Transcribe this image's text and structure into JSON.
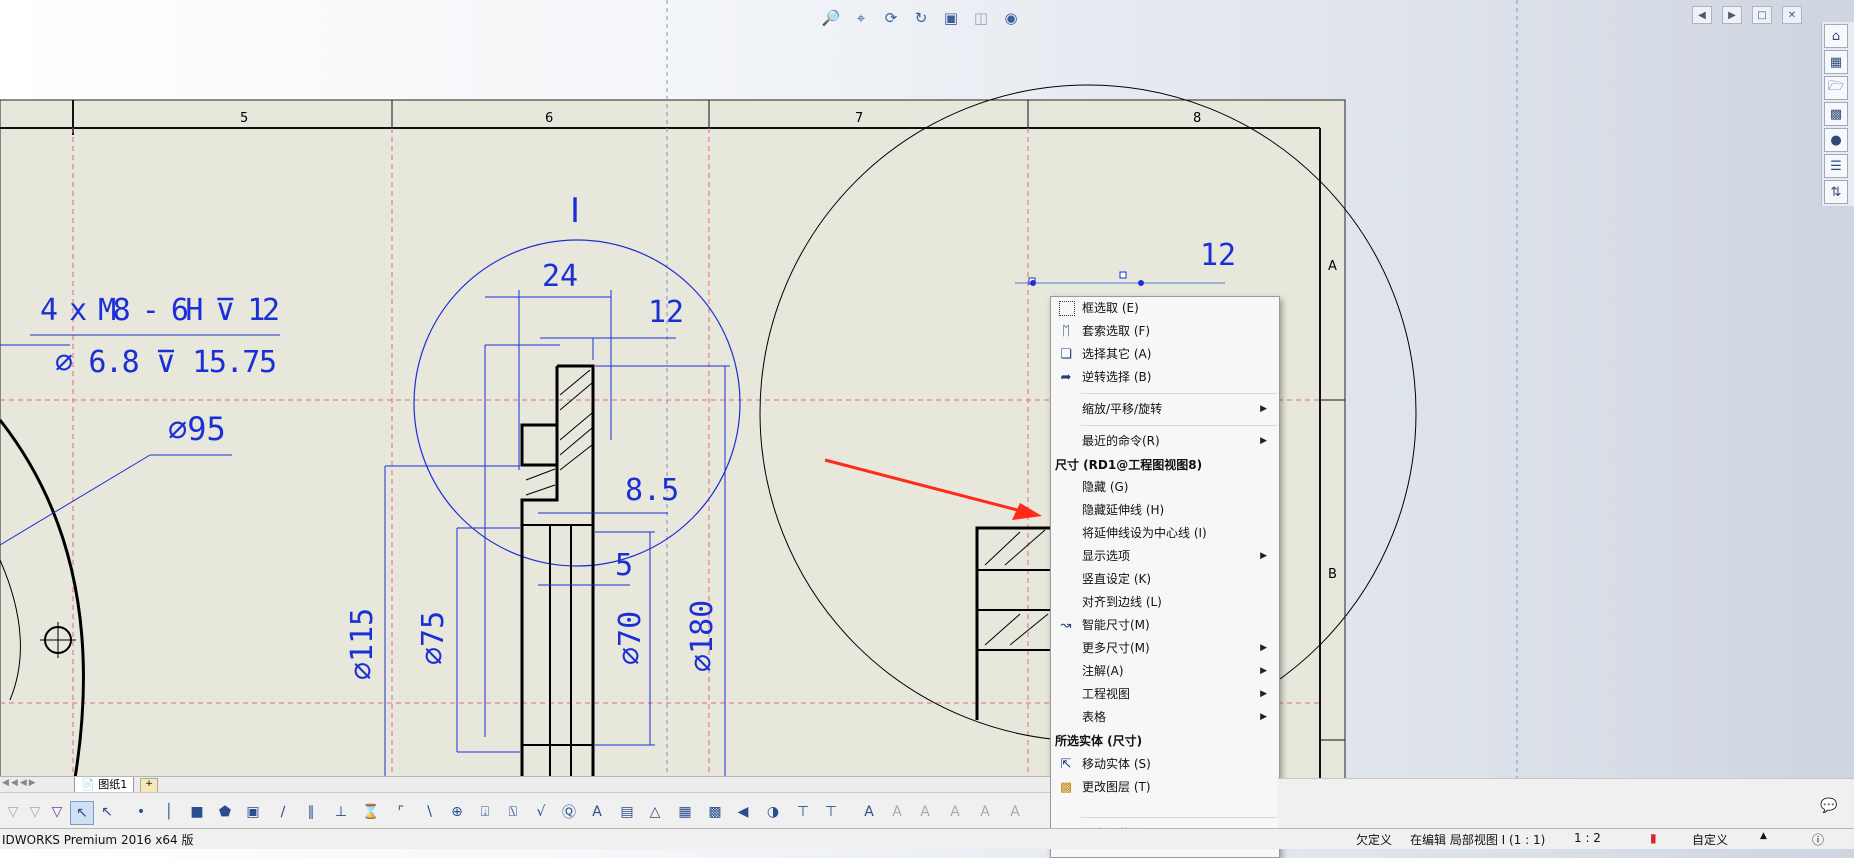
{
  "heads_up_toolbar": {
    "icons": [
      "zoom-fit-icon",
      "zoom-area-icon",
      "previous-view-icon",
      "rotate-icon",
      "section-view-icon",
      "display-style-icon",
      "hide-show-icon"
    ]
  },
  "drawing": {
    "zone_labels": [
      "5",
      "6",
      "7",
      "8"
    ],
    "row_labels": [
      "A",
      "B"
    ],
    "view_label": "I",
    "dimensions": {
      "hole_callout_line1": "4 x M8 - 6H ⊽ 12",
      "hole_callout_line2": "⌀ 6.8 ⊽ 15.75",
      "dia95": "⌀95",
      "d24": "24",
      "d12a": "12",
      "d85": "8.5",
      "d5": "5",
      "dia115": "⌀115",
      "dia75": "⌀75",
      "dia70": "⌀70",
      "dia180": "⌀180",
      "d12b": "12"
    },
    "colors": {
      "sheet": "#e8e7dc",
      "dimension": "#1b2fd6",
      "centerline": "#e26a8a",
      "arrow": "#ff2a1a"
    }
  },
  "context_menu": {
    "items": [
      {
        "icon": "box-select-icon",
        "label": "框选取 (E)"
      },
      {
        "icon": "lasso-select-icon",
        "label": "套索选取 (F)"
      },
      {
        "icon": "select-other-icon",
        "label": "选择其它 (A)"
      },
      {
        "icon": "invert-select-icon",
        "label": "逆转选择 (B)"
      }
    ],
    "zoom_pan_rotate": "缩放/平移/旋转",
    "recent_commands": "最近的命令(R)",
    "dimension_header": "尺寸 (RD1@工程图视图8)",
    "dimension_items": [
      {
        "label": "隐藏 (G)",
        "submenu": false
      },
      {
        "label": "隐藏延伸线 (H)",
        "submenu": false
      },
      {
        "label": "将延伸线设为中心线 (I)",
        "submenu": false
      },
      {
        "label": "显示选项",
        "submenu": true
      },
      {
        "label": "竖直设定 (K)",
        "submenu": false
      },
      {
        "label": "对齐到边线 (L)",
        "submenu": false
      },
      {
        "label": "智能尺寸(M)",
        "submenu": false,
        "icon": "smart-dimension-icon"
      },
      {
        "label": "更多尺寸(M)",
        "submenu": true
      },
      {
        "label": "注解(A)",
        "submenu": true
      },
      {
        "label": "工程视图",
        "submenu": true
      },
      {
        "label": "表格",
        "submenu": true
      }
    ],
    "selected_entity_header": "所选实体 (尺寸)",
    "entity_items": [
      {
        "icon": "move-entity-icon",
        "label": "移动实体 (S)"
      },
      {
        "icon": "change-layer-icon",
        "label": "更改图层 (T)"
      }
    ],
    "customize": "自定义菜单(M)"
  },
  "sheet_tab": {
    "label": "图纸1"
  },
  "status_bar": {
    "app": "IDWORKS Premium 2016 x64 版",
    "underdefined": "欠定义",
    "editing": "在编辑 局部视图 I (1 : 1)",
    "scale": "1 : 2",
    "units": "自定义"
  }
}
